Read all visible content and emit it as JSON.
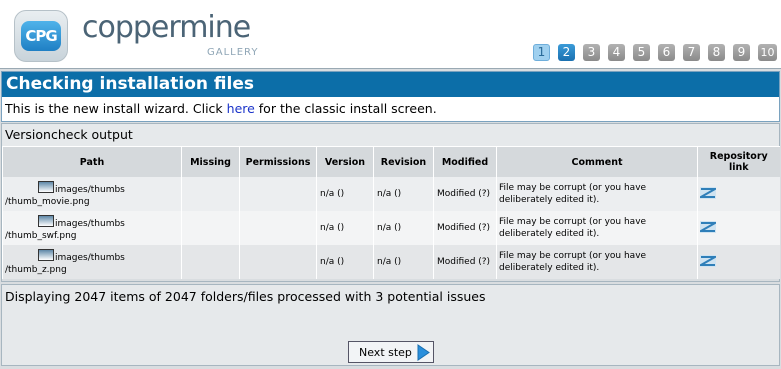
{
  "header": {
    "logo_badge": "CPG",
    "logo_text": "coppermine",
    "logo_sub": "GALLERY",
    "steps": [
      "1",
      "2",
      "3",
      "4",
      "5",
      "6",
      "7",
      "8",
      "9",
      "10"
    ],
    "current_step": "2"
  },
  "title_panel": {
    "title": "Checking installation files",
    "intro_before": "This is the new install wizard. Click ",
    "intro_link": "here",
    "intro_after": " for the classic install screen."
  },
  "versioncheck": {
    "title": "Versioncheck output",
    "columns": [
      "Path",
      "Missing",
      "Permissions",
      "Version",
      "Revision",
      "Modified",
      "Comment",
      "Repository link"
    ],
    "rows": [
      {
        "path_dir": "images/thumbs",
        "path_file": "/thumb_movie.png",
        "missing": "",
        "permissions": "",
        "version": "n/a ()",
        "revision": "n/a ()",
        "modified": "Modified (?)",
        "comment": "File may be corrupt (or you have deliberately edited it).",
        "repo_icon": "repository-link-icon"
      },
      {
        "path_dir": "images/thumbs",
        "path_file": "/thumb_swf.png",
        "missing": "",
        "permissions": "",
        "version": "n/a ()",
        "revision": "n/a ()",
        "modified": "Modified (?)",
        "comment": "File may be corrupt (or you have deliberately edited it).",
        "repo_icon": "repository-link-icon"
      },
      {
        "path_dir": "images/thumbs",
        "path_file": "/thumb_z.png",
        "missing": "",
        "permissions": "",
        "version": "n/a ()",
        "revision": "n/a ()",
        "modified": "Modified (?)",
        "comment": "File may be corrupt (or you have deliberately edited it).",
        "repo_icon": "repository-link-icon"
      }
    ]
  },
  "footer": {
    "summary": "Displaying 2047 items of 2047 folders/files processed with 3 potential issues",
    "next_label": "Next step"
  }
}
